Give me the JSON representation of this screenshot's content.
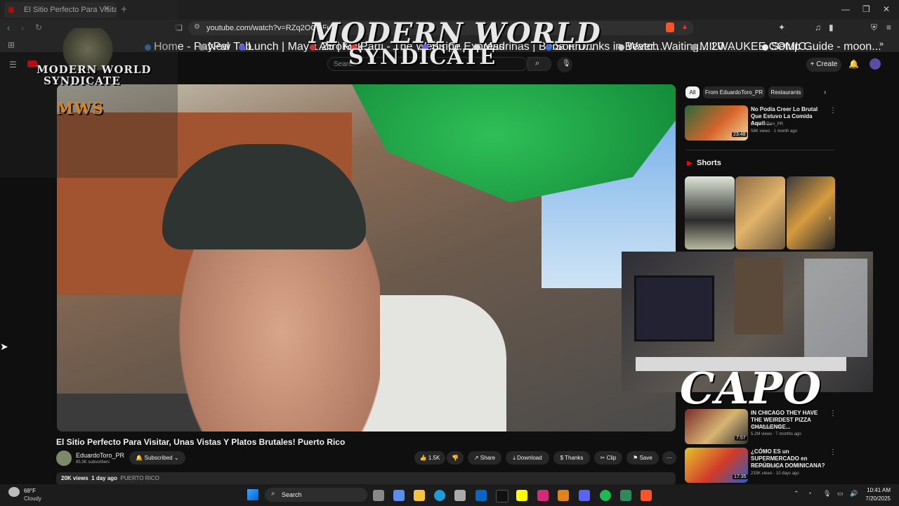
{
  "browser": {
    "tab_title": "El Sitio Perfecto Para Visitar, Unas",
    "url": "youtube.com/watch?v=RZq2OCOFuG",
    "bookmarks": [
      "Home - PayPal",
      "New Tab",
      "Lunch | May 1 25 | R...",
      "AltroKick",
      "Parti - The Web3 Cr...",
      "Stripe Express",
      "Madrinas | Boba Fru...",
      "Soft Drinks in Bever...",
      "Watch Waiting... 20...",
      "MILWAUKEE COMIC...",
      "Setup Guide - moon..."
    ]
  },
  "youtube": {
    "search_placeholder": "Search",
    "create_label": "Create",
    "video": {
      "title": "El Sitio Perfecto Para Visitar, Unas Vistas Y Platos Brutales! Puerto Rico",
      "channel": "EduardoToro_PR",
      "subscribers": "85.3K subscribers",
      "subscribed_label": "Subscribed",
      "likes": "1.5K",
      "share_label": "Share",
      "download_label": "Download",
      "thanks_label": "Thanks",
      "clip_label": "Clip",
      "save_label": "Save",
      "views": "20K views",
      "age": "1 day ago",
      "tag": "PUERTO RICO"
    },
    "chips": [
      "All",
      "From EduardoToro_PR",
      "Restaurants"
    ],
    "recommended": [
      {
        "title": "No Podía Creer Lo Brutal Que Estuvo La Comida Aquí! ...",
        "channel": "EduardoToro_PR",
        "meta": "58K views · 1 month ago",
        "duration": "23:48"
      },
      {
        "title": "IN CHICAGO THEY HAVE THE WEIRDEST PIZZA CHALLENGE...",
        "channel": "BeardMeatsFood",
        "meta": "5.2M views · 7 months ago",
        "duration": "7:57"
      },
      {
        "title": "¿CÓMO ES un SUPERMERCADO en REPÚBLICA DOMINICANA?",
        "channel": "Consumo Vlogs",
        "meta": "233K views · 10 days ago",
        "duration": "17:35"
      }
    ],
    "shorts_label": "Shorts"
  },
  "overlay": {
    "modern": "MODERN WORLD",
    "syndicate": "SYNDICATE",
    "logo_line1": "MODERN WORLD",
    "logo_line2": "SYNDICATE",
    "logo_mws": "MWS",
    "capo": "CAPO"
  },
  "taskbar": {
    "temp": "68°F",
    "weather": "Cloudy",
    "search_label": "Search",
    "time": "10:41 AM",
    "date": "7/20/2025"
  }
}
